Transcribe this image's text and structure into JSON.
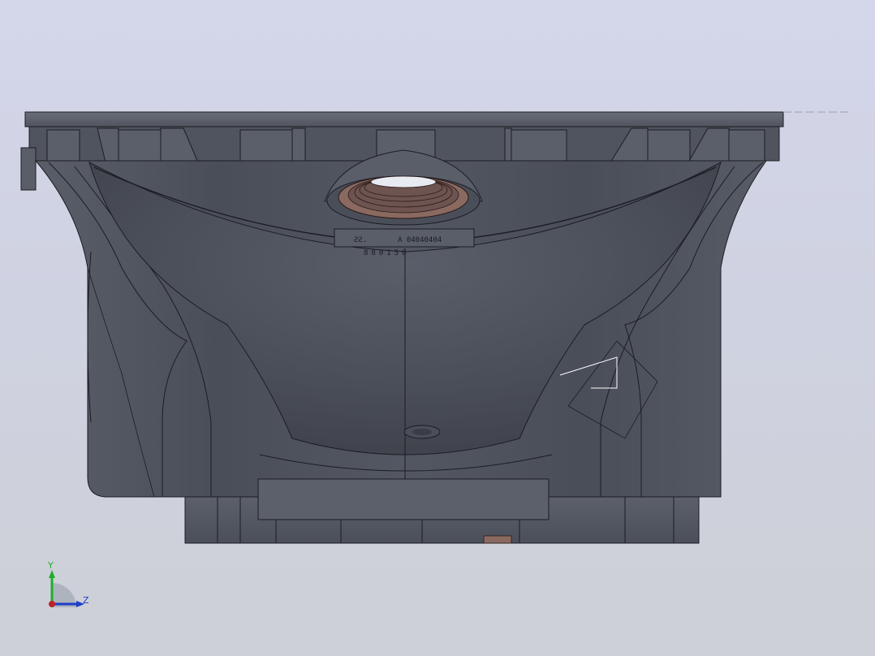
{
  "viewport": {
    "background_top": "#d4d6ea",
    "background_bottom": "#ced0d7"
  },
  "model": {
    "part_color": "#4a4e58",
    "edge_color": "#1b1d22",
    "thread_color": "#8a6a60",
    "engraving": {
      "logo": "ƧƧ.",
      "part_number": "A 04040404",
      "serial": "880156"
    }
  },
  "triad": {
    "y_label": "Y",
    "z_label": "Z",
    "y_color": "#1fae2e",
    "z_color": "#1e3ec8",
    "x_color": "#c0202a"
  }
}
